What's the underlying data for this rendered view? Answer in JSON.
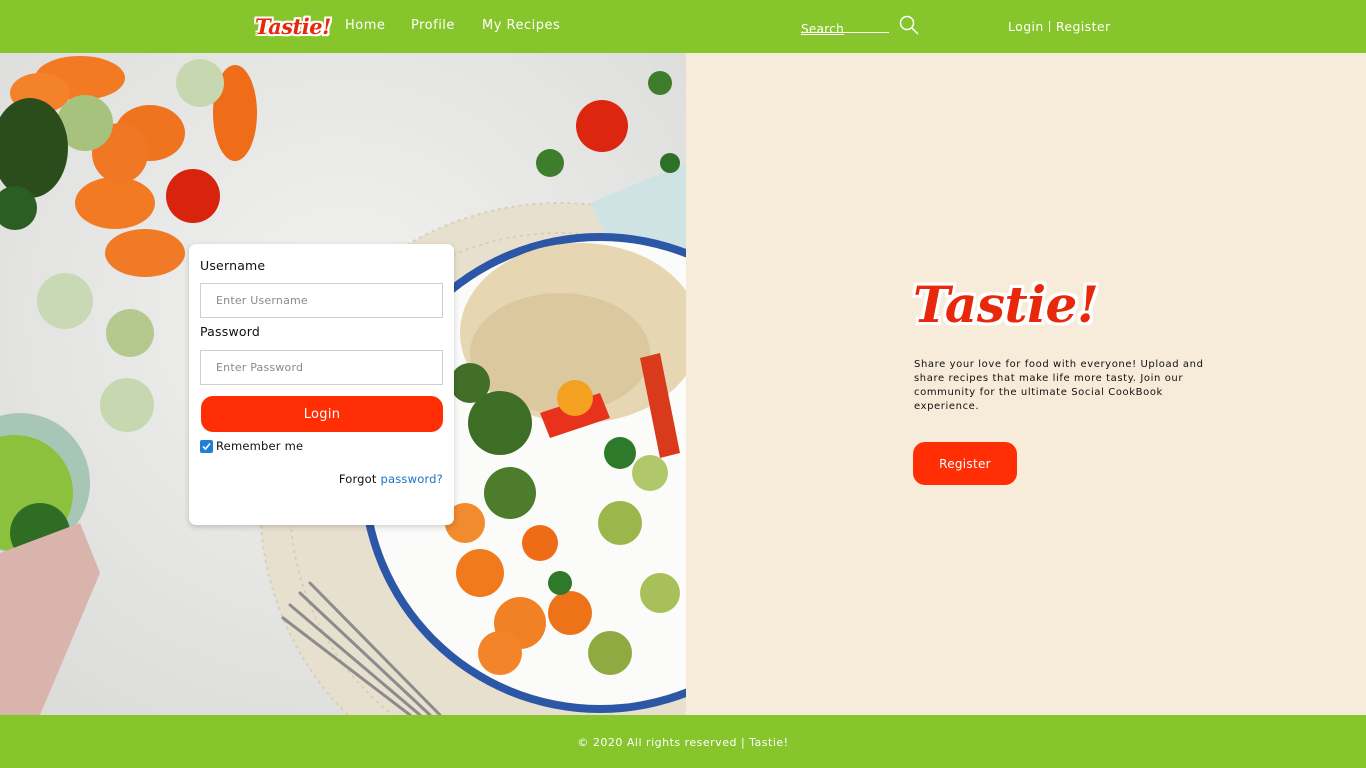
{
  "brand": {
    "name": "Tastie!",
    "primary_color": "#86c52b",
    "accent_color": "#ff2e05",
    "panel_color": "#f6ecd9"
  },
  "nav": {
    "logo": "Tastie!",
    "links": [
      {
        "label": "Home"
      },
      {
        "label": "Profile"
      },
      {
        "label": "My Recipes"
      }
    ],
    "search_placeholder": "Search",
    "search_icon": "search-icon",
    "login_label": "Login",
    "separator": "|",
    "register_label": "Register"
  },
  "login_form": {
    "username_label": "Username",
    "username_placeholder": "Enter Username",
    "password_label": "Password",
    "password_placeholder": "Enter Password",
    "login_button": "Login",
    "remember_label": "Remember me",
    "remember_checked": true,
    "forgot_prefix": "Forgot",
    "forgot_link": "password?"
  },
  "promo": {
    "logo": "Tastie!",
    "tagline": "Share your love for food with everyone! Upload and share recipes that make life more tasty. Join our community for the ultimate Social CookBook experience.",
    "register_button": "Register"
  },
  "footer": {
    "text": "© 2020 All rights reserved | Tastie!"
  }
}
